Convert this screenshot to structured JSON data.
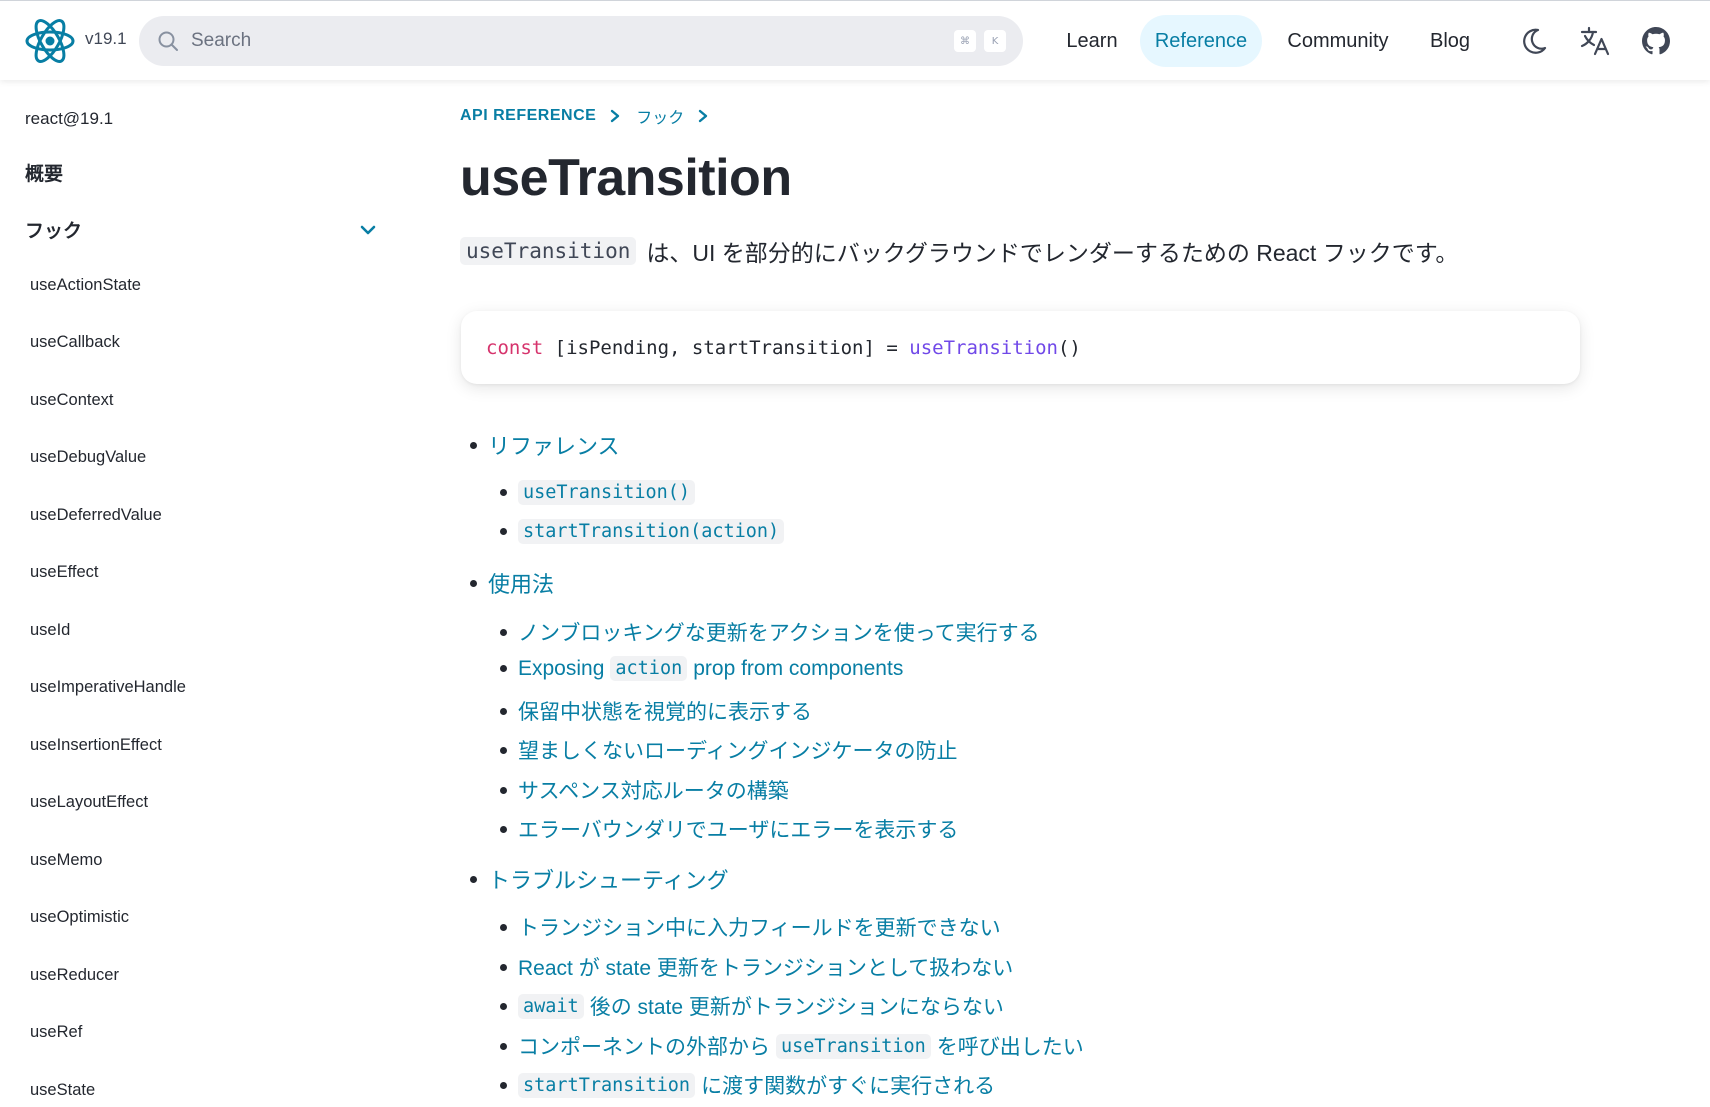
{
  "header": {
    "version": "v19.1",
    "search": {
      "placeholder": "Search",
      "kbd_cmd": "⌘",
      "kbd_key": "K"
    },
    "nav": [
      {
        "label": "Learn",
        "active": false
      },
      {
        "label": "Reference",
        "active": true
      },
      {
        "label": "Community",
        "active": false
      },
      {
        "label": "Blog",
        "active": false
      }
    ],
    "icons": [
      "moon-icon",
      "translate-icon",
      "github-icon"
    ]
  },
  "sidebar": {
    "version": "react@19.1",
    "overview": "概要",
    "section": "フック",
    "items": [
      "useActionState",
      "useCallback",
      "useContext",
      "useDebugValue",
      "useDeferredValue",
      "useEffect",
      "useId",
      "useImperativeHandle",
      "useInsertionEffect",
      "useLayoutEffect",
      "useMemo",
      "useOptimistic",
      "useReducer",
      "useRef",
      "useState"
    ]
  },
  "main": {
    "breadcrumb": [
      "API REFERENCE",
      "フック"
    ],
    "title": "useTransition",
    "intro": {
      "code": "useTransition",
      "text": "は、UI を部分的にバックグラウンドでレンダーするための React フックです。"
    },
    "code": {
      "kw": "const",
      "mid": " [isPending, startTransition] = ",
      "fn": "useTransition",
      "end": "()"
    },
    "toc": {
      "ref": {
        "label": "リファレンス",
        "items": [
          "useTransition()",
          "startTransition(action)"
        ]
      },
      "usage": {
        "label": "使用法",
        "items": [
          "ノンブロッキングな更新をアクションを使って実行する",
          {
            "pre": "Exposing",
            "code": "action",
            "post": "prop from components"
          },
          "保留中状態を視覚的に表示する",
          "望ましくないローディングインジケータの防止",
          "サスペンス対応ルータの構築",
          "エラーバウンダリでユーザにエラーを表示する"
        ]
      },
      "trouble": {
        "label": "トラブルシューティング",
        "items": [
          "トランジション中に入力フィールドを更新できない",
          "React が state 更新をトランジションとして扱わない",
          {
            "code": "await",
            "post": "後の state 更新がトランジションにならない"
          },
          {
            "pre": "コンポーネントの外部から",
            "code": "useTransition",
            "post": "を呼び出したい"
          },
          {
            "code": "startTransition",
            "post": "に渡す関数がすぐに実行される"
          }
        ]
      }
    }
  },
  "colors": {
    "link": "#087ea4",
    "text": "#23272f",
    "active_bg": "#e6f7ff",
    "keyword": "#d6336c",
    "function": "#7048e8"
  }
}
